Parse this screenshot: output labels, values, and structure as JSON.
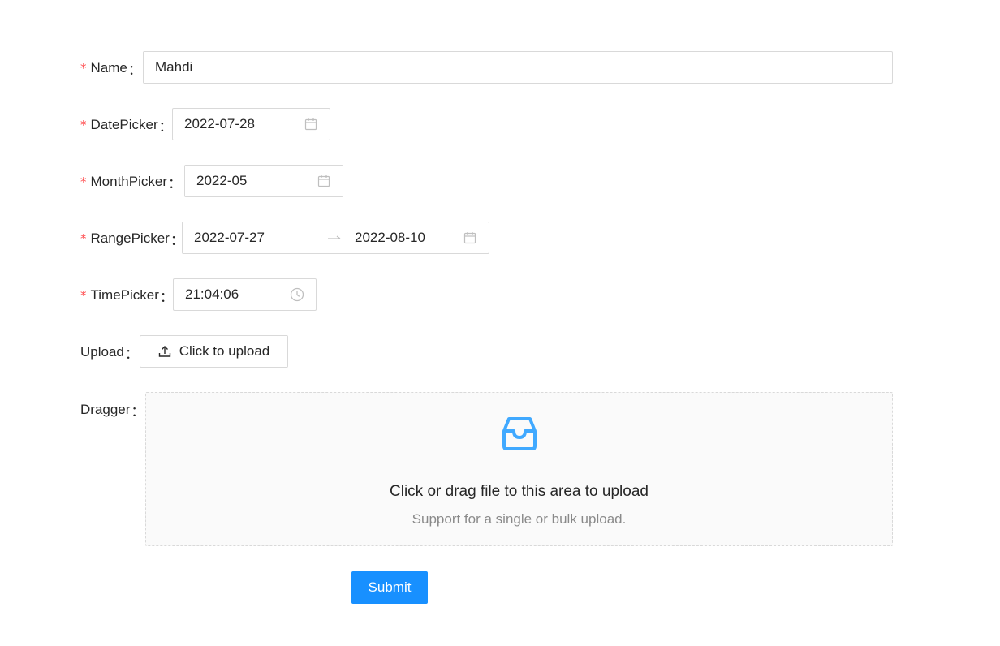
{
  "form": {
    "name": {
      "label": "Name",
      "required": true,
      "value": "Mahdi"
    },
    "date_picker": {
      "label": "DatePicker",
      "required": true,
      "value": "2022-07-28",
      "icon": "calendar-icon"
    },
    "month_picker": {
      "label": "MonthPicker",
      "required": true,
      "value": "2022-05",
      "icon": "calendar-icon"
    },
    "range_picker": {
      "label": "RangePicker",
      "required": true,
      "start": "2022-07-27",
      "end": "2022-08-10",
      "icon": "calendar-icon"
    },
    "time_picker": {
      "label": "TimePicker",
      "required": true,
      "value": "21:04:06",
      "icon": "clock-icon"
    },
    "upload": {
      "label": "Upload",
      "button_label": "Click to upload",
      "icon": "upload-icon"
    },
    "dragger": {
      "label": "Dragger",
      "icon": "inbox-icon",
      "text": "Click or drag file to this area to upload",
      "hint": "Support for a single or bulk upload."
    },
    "submit_label": "Submit",
    "required_mark": "*",
    "colon": "："
  },
  "colors": {
    "primary": "#1890ff",
    "required": "#ff4d4f",
    "border": "#d9d9d9"
  }
}
